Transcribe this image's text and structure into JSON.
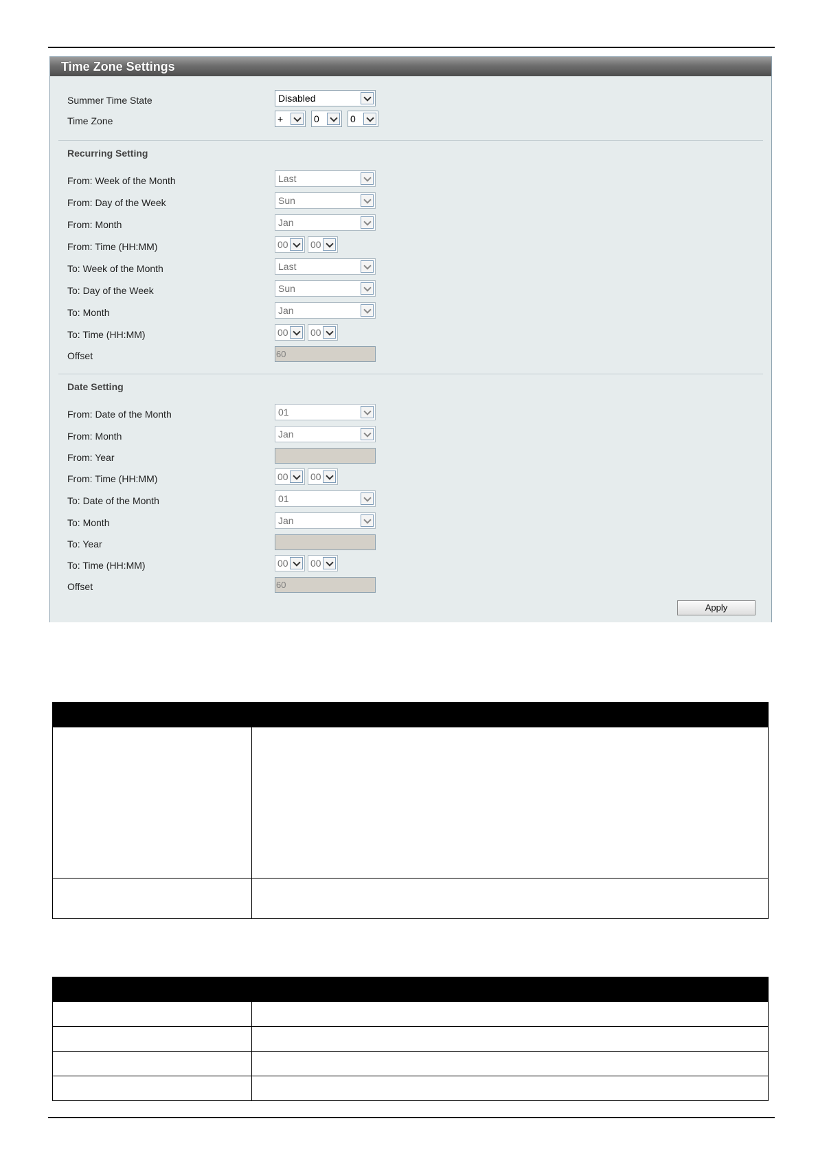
{
  "panel": {
    "title": "Time Zone Settings"
  },
  "summer_time_state": {
    "label": "Summer Time State",
    "value": "Disabled"
  },
  "time_zone": {
    "label": "Time Zone",
    "sign": "+",
    "hour": "0",
    "minute": "0"
  },
  "recurring": {
    "heading": "Recurring Setting",
    "from_week": {
      "label": "From: Week of the Month",
      "value": "Last"
    },
    "from_day": {
      "label": "From: Day of the Week",
      "value": "Sun"
    },
    "from_month": {
      "label": "From: Month",
      "value": "Jan"
    },
    "from_time": {
      "label": "From: Time (HH:MM)",
      "hh": "00",
      "mm": "00"
    },
    "to_week": {
      "label": "To: Week of the Month",
      "value": "Last"
    },
    "to_day": {
      "label": "To: Day of the Week",
      "value": "Sun"
    },
    "to_month": {
      "label": "To: Month",
      "value": "Jan"
    },
    "to_time": {
      "label": "To: Time (HH:MM)",
      "hh": "00",
      "mm": "00"
    },
    "offset": {
      "label": "Offset",
      "value": "60"
    }
  },
  "date": {
    "heading": "Date Setting",
    "from_date": {
      "label": "From: Date of the Month",
      "value": "01"
    },
    "from_month": {
      "label": "From: Month",
      "value": "Jan"
    },
    "from_year": {
      "label": "From: Year",
      "value": ""
    },
    "from_time": {
      "label": "From: Time (HH:MM)",
      "hh": "00",
      "mm": "00"
    },
    "to_date": {
      "label": "To: Date of the Month",
      "value": "01"
    },
    "to_month": {
      "label": "To: Month",
      "value": "Jan"
    },
    "to_year": {
      "label": "To: Year",
      "value": ""
    },
    "to_time": {
      "label": "To: Time (HH:MM)",
      "hh": "00",
      "mm": "00"
    },
    "offset": {
      "label": "Offset",
      "value": "60"
    }
  },
  "apply_label": "Apply"
}
